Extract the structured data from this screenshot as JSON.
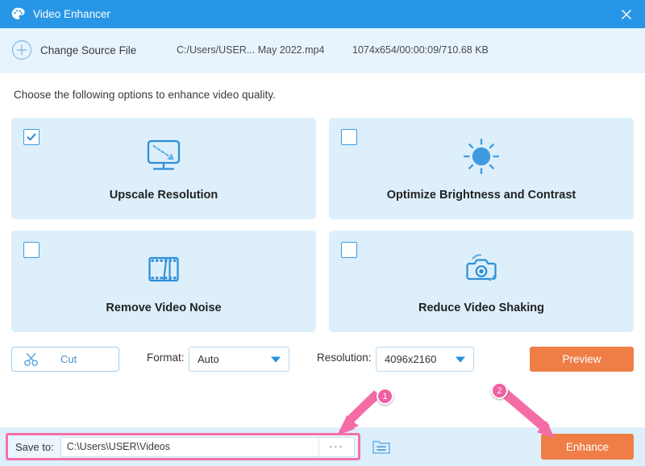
{
  "window": {
    "title": "Video Enhancer",
    "app_icon": "palette-icon",
    "close_icon": "close-icon",
    "titlebar_color": "#2896e6"
  },
  "source_bar": {
    "add_icon": "plus-circle-icon",
    "change_source_label": "Change Source File",
    "file_path": "C:/Users/USER... May 2022.mp4",
    "file_meta": "1074x654/00:00:09/710.68 KB"
  },
  "main": {
    "instruction": "Choose the following options to enhance video quality.",
    "options": [
      {
        "label": "Upscale Resolution",
        "checked": true,
        "icon": "monitor-upscale-icon"
      },
      {
        "label": "Optimize Brightness and Contrast",
        "checked": false,
        "icon": "sun-brightness-icon"
      },
      {
        "label": "Remove Video Noise",
        "checked": false,
        "icon": "film-strip-icon"
      },
      {
        "label": "Reduce Video Shaking",
        "checked": false,
        "icon": "camera-shake-icon"
      }
    ]
  },
  "controls": {
    "cut_label": "Cut",
    "cut_icon": "scissors-icon",
    "format_label": "Format:",
    "format_value": "Auto",
    "resolution_label": "Resolution:",
    "resolution_value": "4096x2160",
    "preview_label": "Preview"
  },
  "bottom_bar": {
    "save_to_label": "Save to:",
    "save_to_path": "C:\\Users\\USER\\Videos",
    "browse_label": "...",
    "folder_icon": "folder-icon",
    "enhance_label": "Enhance"
  },
  "annotations": {
    "badge_one": "1",
    "badge_two": "2",
    "highlight_color": "#f470a8",
    "accent_color": "#ef7e46"
  }
}
